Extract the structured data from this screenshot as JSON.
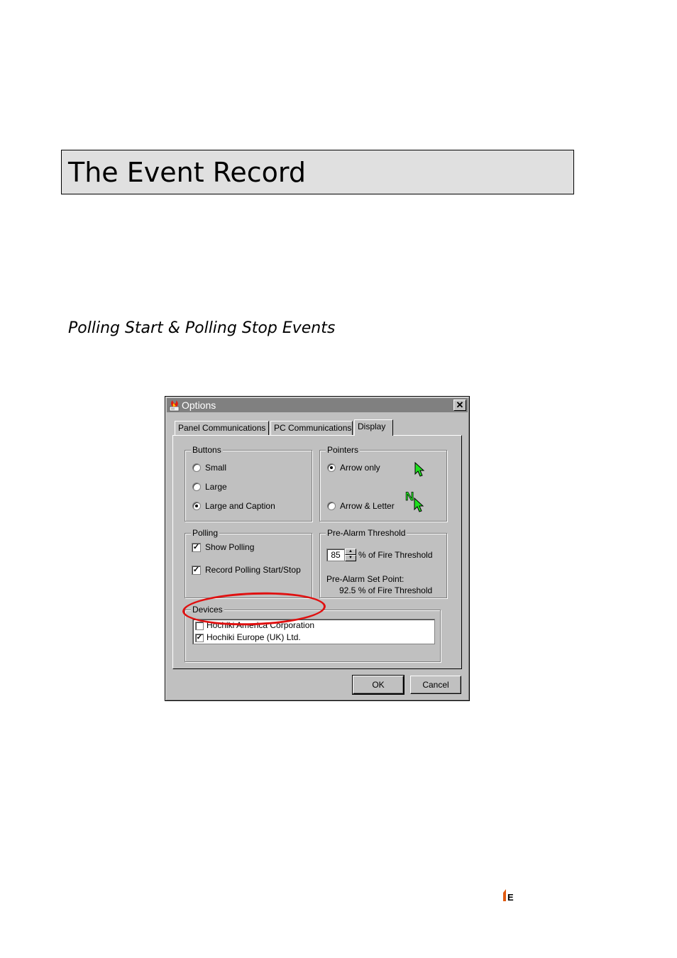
{
  "page": {
    "title": "The Event Record",
    "section_heading": "Polling Start & Polling Stop Events"
  },
  "dialog": {
    "title": "Options",
    "close_icon": "close-icon",
    "tabs": [
      {
        "label": "Panel Communications",
        "active": false
      },
      {
        "label": "PC Communications",
        "active": false
      },
      {
        "label": "Display",
        "active": true
      }
    ],
    "buttons_group": {
      "label": "Buttons",
      "options": [
        {
          "label": "Small",
          "selected": false
        },
        {
          "label": "Large",
          "selected": false
        },
        {
          "label": "Large and Caption",
          "selected": true
        }
      ]
    },
    "pointers_group": {
      "label": "Pointers",
      "options": [
        {
          "label": "Arrow only",
          "selected": true,
          "icon": "green-arrow-pointer-icon"
        },
        {
          "label": "Arrow & Letter",
          "selected": false,
          "icon": "green-arrow-letter-pointer-icon",
          "letter": "N"
        }
      ]
    },
    "polling_group": {
      "label": "Polling",
      "options": [
        {
          "label": "Show Polling",
          "checked": true
        },
        {
          "label": "Record Polling Start/Stop",
          "checked": true
        }
      ]
    },
    "prealarm_group": {
      "label": "Pre-Alarm Threshold",
      "value": "85",
      "value_suffix": "% of Fire Threshold",
      "set_point_label": "Pre-Alarm Set Point:",
      "set_point_value": "92.5 % of Fire Threshold"
    },
    "devices_group": {
      "label": "Devices",
      "items": [
        {
          "label": "Hochiki America Corporation",
          "checked": false
        },
        {
          "label": "Hochiki Europe (UK) Ltd.",
          "checked": true
        }
      ]
    },
    "ok_label": "OK",
    "cancel_label": "Cancel",
    "highlight_color": "#e01010"
  },
  "footer": {
    "logo_icon": "hochiki-logo-icon",
    "logo_letter": "E"
  }
}
